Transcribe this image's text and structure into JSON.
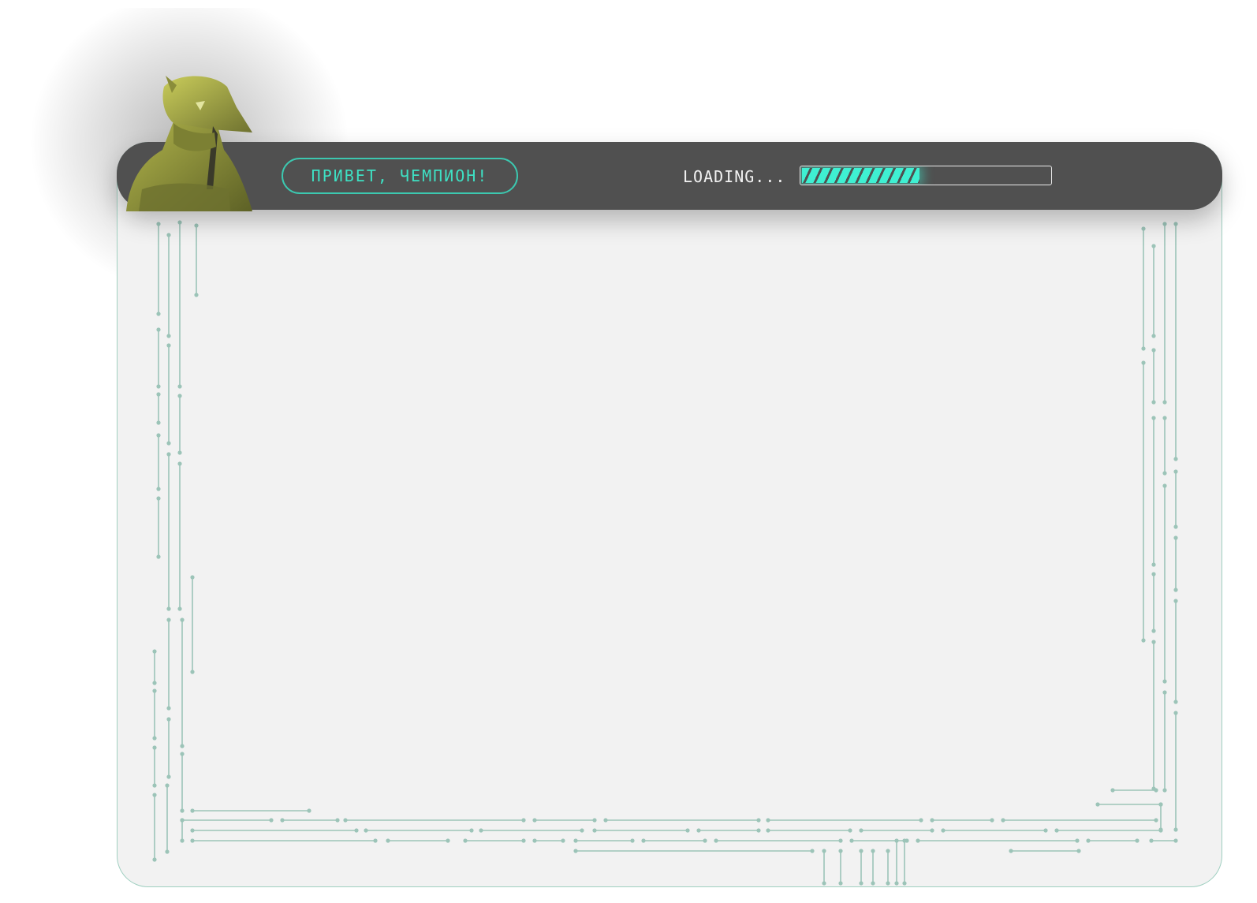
{
  "header": {
    "greeting_label": "ПРИВЕТ, ЧЕМПИОН!",
    "loading_label": "LOADING...",
    "progress_fraction": 0.48
  },
  "colors": {
    "header_bg": "#505050",
    "panel_bg": "#f2f2f2",
    "accent": "#3ff0d2",
    "circuit": "#9cc4b8"
  },
  "icons": {
    "avatar": "hooded-soldier-avatar-icon"
  }
}
